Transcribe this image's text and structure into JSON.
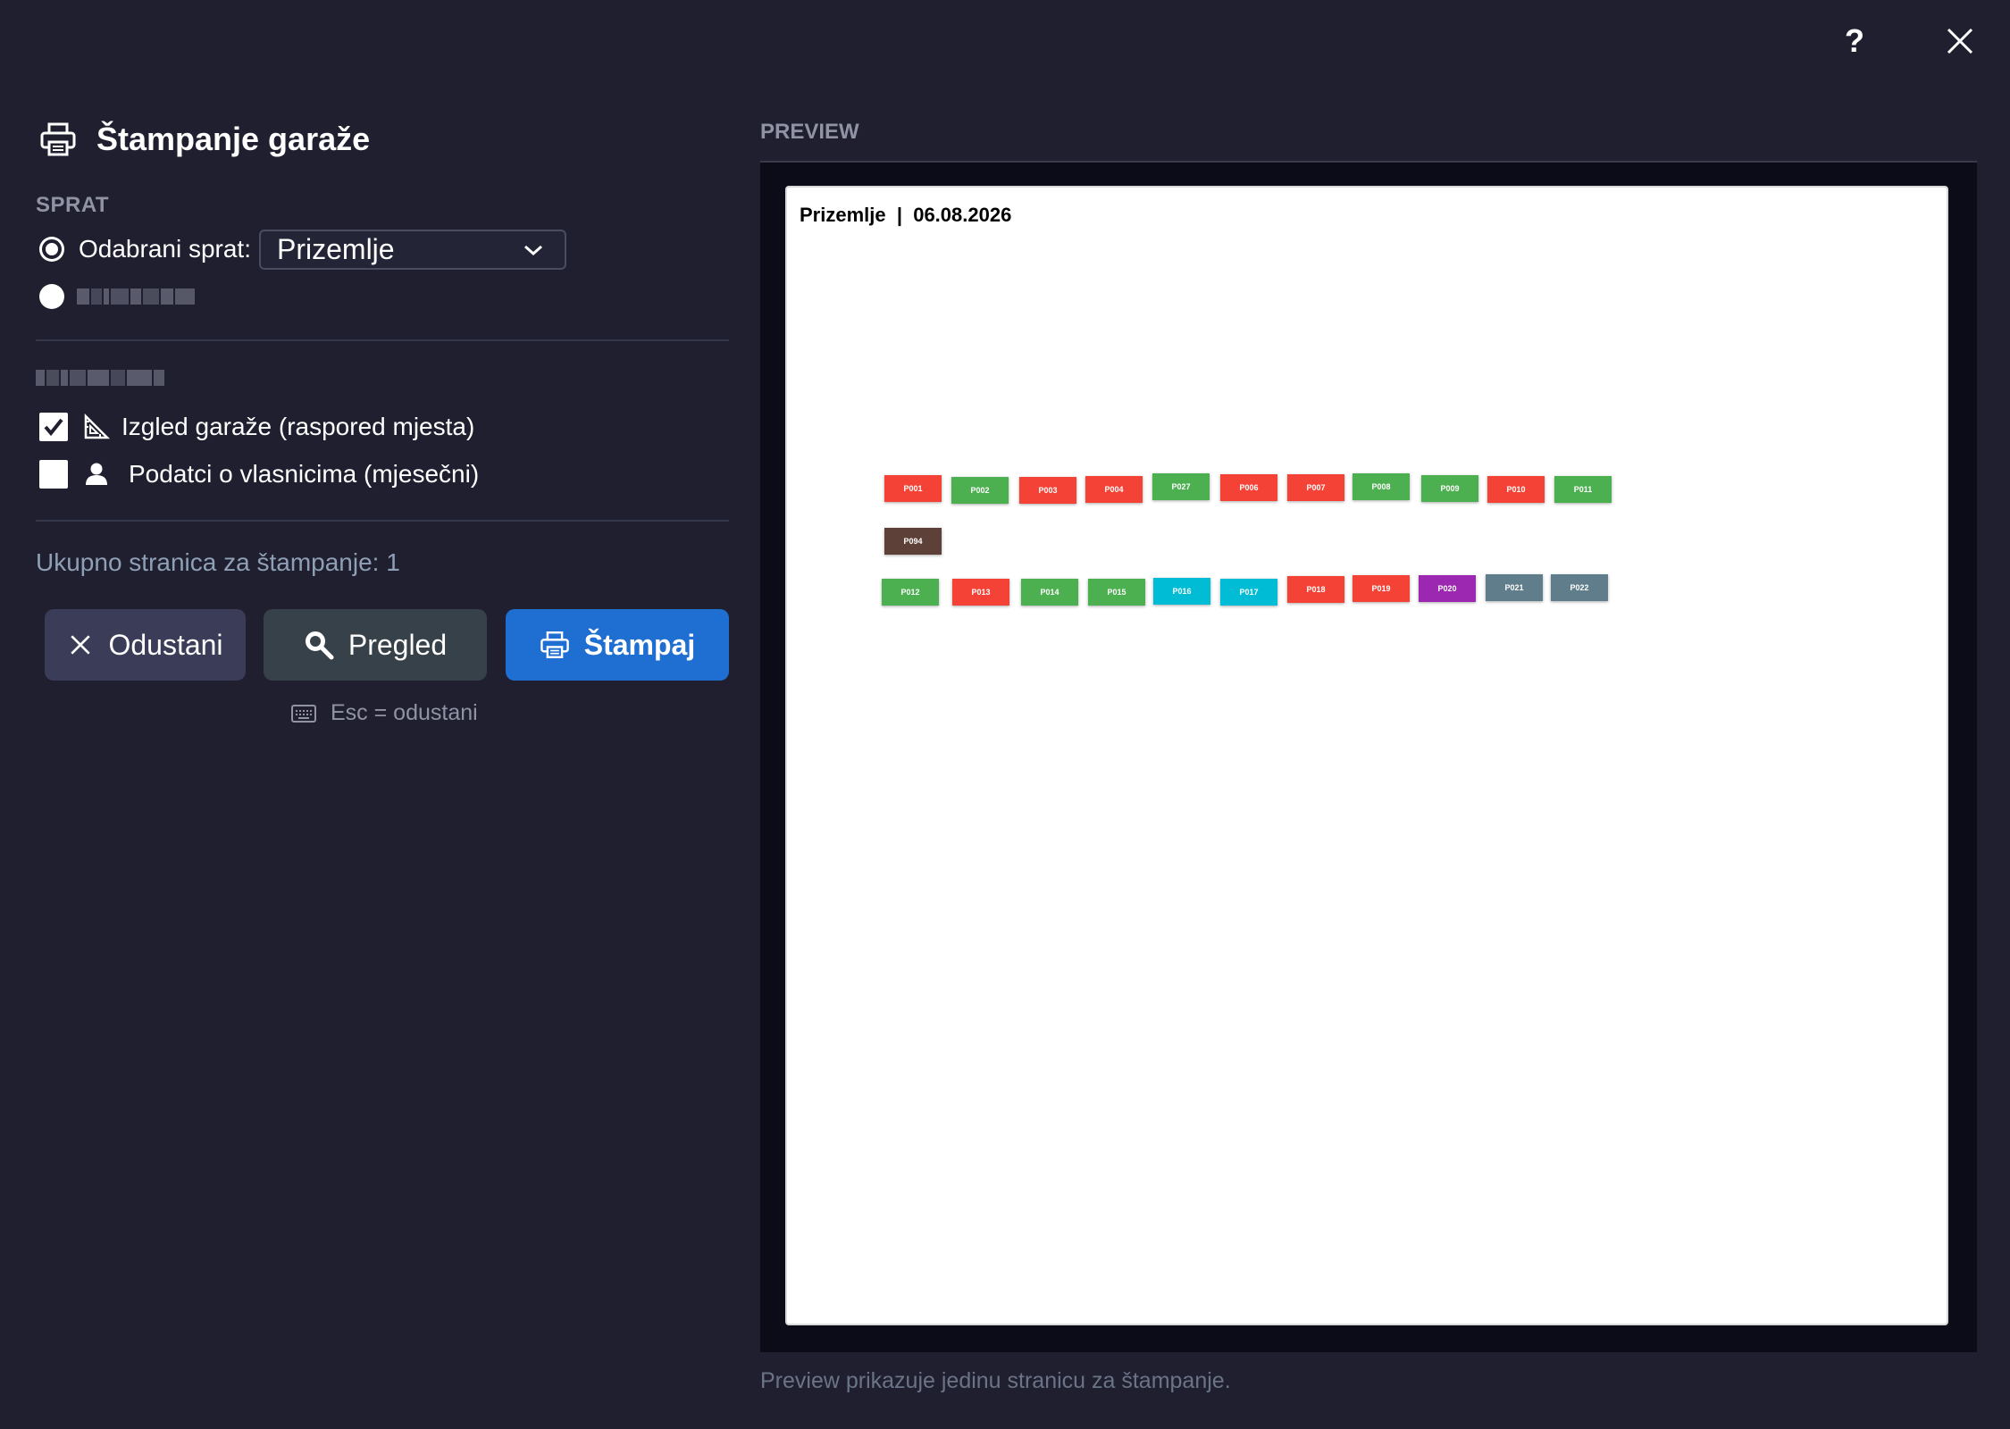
{
  "window": {
    "help_label": "?",
    "help_icon": "question-mark-icon",
    "close_icon": "close-icon"
  },
  "dialog": {
    "title": "Štampanje garaže",
    "title_icon": "printer-icon"
  },
  "floor_section": {
    "label": "SPRAT",
    "option_selected": {
      "label": "Odabrani sprat:",
      "checked": true
    },
    "floor_select": {
      "value": "Prizemlje",
      "icon": "chevron-down-icon"
    },
    "option_all": {
      "label_redacted": true,
      "checked": false
    }
  },
  "content_section": {
    "label_redacted": true,
    "items": [
      {
        "label": "Izgled garaže (raspored mjesta)",
        "checked": true,
        "icon": "triangle-ruler-icon"
      },
      {
        "label": "Podatci o vlasnicima (mjesečni)",
        "checked": false,
        "icon": "user-icon"
      }
    ]
  },
  "total_pages": "Ukupno stranica za štampanje: 1",
  "buttons": {
    "cancel": {
      "label": "Odustani",
      "icon": "close-icon"
    },
    "preview": {
      "label": "Pregled",
      "icon": "magnifier-icon"
    },
    "print": {
      "label": "Štampaj",
      "icon": "printer-icon"
    }
  },
  "hint": {
    "text": "Esc = odustani",
    "icon": "keyboard-icon"
  },
  "preview": {
    "label": "PREVIEW",
    "page_header": "Prizemlje  |  06.08.2026",
    "footer": "Preview prikazuje jedinu stranicu za štampanje.",
    "colors": {
      "red": "#f44336",
      "green": "#4caf50",
      "brown": "#5d4037",
      "cyan": "#00bcd4",
      "purple": "#9c27b0",
      "gray": "#607d8b"
    },
    "rows": [
      [
        {
          "label": "P001",
          "color": "red"
        },
        {
          "label": "P002",
          "color": "green"
        },
        {
          "label": "P003",
          "color": "red"
        },
        {
          "label": "P004",
          "color": "red"
        },
        {
          "label": "P027",
          "color": "green"
        },
        {
          "label": "P006",
          "color": "red"
        },
        {
          "label": "P007",
          "color": "red"
        },
        {
          "label": "P008",
          "color": "green"
        },
        {
          "label": "P009",
          "color": "green"
        },
        {
          "label": "P010",
          "color": "red"
        },
        {
          "label": "P011",
          "color": "green"
        }
      ],
      [
        {
          "label": "P094",
          "color": "brown"
        }
      ],
      [
        {
          "label": "P012",
          "color": "green"
        },
        {
          "label": "P013",
          "color": "red"
        },
        {
          "label": "P014",
          "color": "green"
        },
        {
          "label": "P015",
          "color": "green"
        },
        {
          "label": "P016",
          "color": "cyan"
        },
        {
          "label": "P017",
          "color": "cyan"
        },
        {
          "label": "P018",
          "color": "red"
        },
        {
          "label": "P019",
          "color": "red"
        },
        {
          "label": "P020",
          "color": "purple"
        },
        {
          "label": "P021",
          "color": "gray"
        },
        {
          "label": "P022",
          "color": "gray"
        }
      ]
    ]
  }
}
